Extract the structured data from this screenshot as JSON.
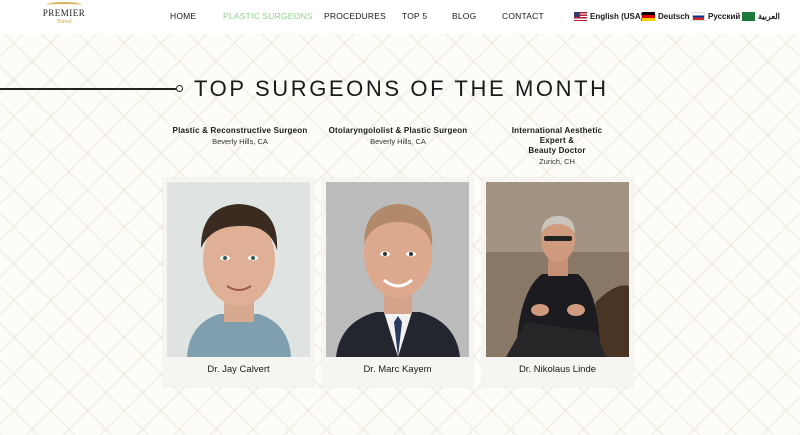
{
  "header": {
    "logo": {
      "main": "PREMIER",
      "sub": "Travel"
    },
    "nav": [
      {
        "label": "HOME",
        "active": false
      },
      {
        "label": "PLASTIC SURGEONS",
        "active": true
      },
      {
        "label": "PROCEDURES",
        "active": false
      },
      {
        "label": "TOP 5",
        "active": false
      },
      {
        "label": "BLOG",
        "active": false
      },
      {
        "label": "CONTACT",
        "active": false
      }
    ],
    "languages": [
      {
        "label": "English (USA)",
        "flag": "us-flag-icon"
      },
      {
        "label": "Deutsch",
        "flag": "germany-flag-icon"
      },
      {
        "label": "Русский",
        "flag": "russia-flag-icon"
      },
      {
        "label": "العربية",
        "flag": "saudi-flag-icon"
      }
    ]
  },
  "section": {
    "title": "TOP SURGEONS OF THE MONTH"
  },
  "surgeons": [
    {
      "specialty_lines": [
        "Plastic & Reconstructive Surgeon"
      ],
      "location": "Beverly Hills, CA",
      "name": "Dr. Jay Calvert"
    },
    {
      "specialty_lines": [
        "Otolaryngololist & Plastic Surgeon"
      ],
      "location": "Beverly Hills, CA",
      "name": "Dr. Marc Kayem"
    },
    {
      "specialty_lines": [
        "International Aesthetic",
        "Expert &",
        "Beauty Doctor"
      ],
      "location": "Zurich, CH",
      "name": "Dr. Nikolaus Linde"
    }
  ],
  "colors": {
    "active_nav": "#8fd48a",
    "logo_gold": "#d9b25a",
    "text": "#1a1a1a",
    "card_bg": "#f6f5f2"
  }
}
